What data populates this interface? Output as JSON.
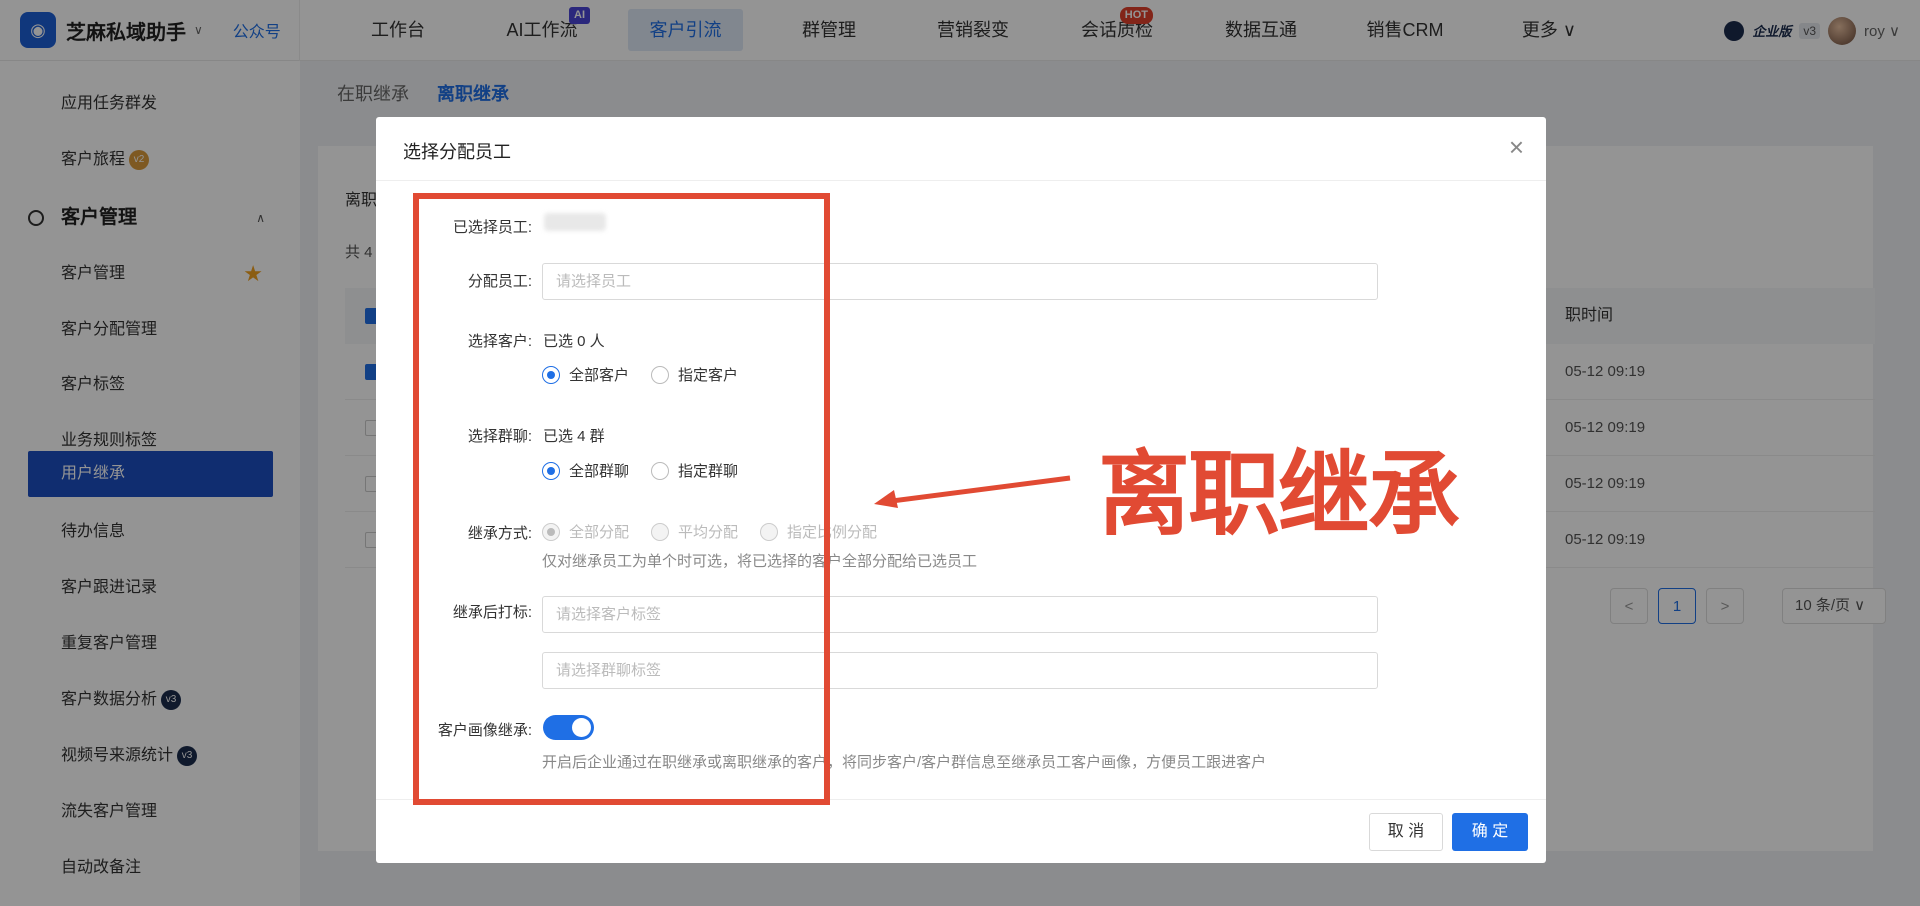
{
  "topbar": {
    "brand": "芝麻私域助手",
    "brand_link": "公众号",
    "nav": [
      {
        "label": "工作台"
      },
      {
        "label": "AI工作流",
        "badge": "AI"
      },
      {
        "label": "客户引流",
        "active": true
      },
      {
        "label": "群管理"
      },
      {
        "label": "营销裂变"
      },
      {
        "label": "会话质检",
        "badge": "HOT"
      },
      {
        "label": "数据互通"
      },
      {
        "label": "销售CRM"
      },
      {
        "label": "更多 ∨"
      }
    ],
    "edition": "企业版",
    "version": "v3",
    "user": "roy ∨"
  },
  "sidebar": {
    "items": [
      {
        "label": "应用任务群发"
      },
      {
        "label": "客户旅程",
        "tag": "v2"
      },
      {
        "label": "客户管理",
        "group": true
      },
      {
        "label": "客户管理",
        "star": true
      },
      {
        "label": "客户分配管理"
      },
      {
        "label": "客户标签"
      },
      {
        "label": "业务规则标签"
      },
      {
        "label": "用户继承",
        "active": true
      },
      {
        "label": "待办信息"
      },
      {
        "label": "客户跟进记录"
      },
      {
        "label": "重复客户管理"
      },
      {
        "label": "客户数据分析",
        "tag": "v3"
      },
      {
        "label": "视频号来源统计",
        "tag": "v3"
      },
      {
        "label": "流失客户管理"
      },
      {
        "label": "自动改备注"
      }
    ]
  },
  "page": {
    "tabs": [
      "在职继承",
      "离职继承"
    ],
    "card_title": "离职",
    "total": "共 4",
    "time_header": "职时间",
    "rows": [
      "05-12 09:19",
      "05-12 09:19",
      "05-12 09:19",
      "05-12 09:19"
    ],
    "pager": {
      "prev": "<",
      "current": "1",
      "next": ">",
      "size": "10 条/页 ∨"
    }
  },
  "modal": {
    "title": "选择分配员工",
    "close": "×",
    "selected_label": "已选择员工:",
    "assign_label": "分配员工:",
    "assign_placeholder": "请选择员工",
    "customer_label": "选择客户:",
    "customer_count": "已选 0 人",
    "customer_options": [
      "全部客户",
      "指定客户"
    ],
    "group_label": "选择群聊:",
    "group_count": "已选 4 群",
    "group_options": [
      "全部群聊",
      "指定群聊"
    ],
    "method_label": "继承方式:",
    "method_options": [
      "全部分配",
      "平均分配",
      "指定比例分配"
    ],
    "method_hint": "仅对继承员工为单个时可选，将已选择的客户全部分配给已选员工",
    "tag_label": "继承后打标:",
    "customer_tag_placeholder": "请选择客户标签",
    "group_tag_placeholder": "请选择群聊标签",
    "portrait_label": "客户画像继承:",
    "portrait_on": true,
    "portrait_hint": "开启后企业通过在职继承或离职继承的客户，将同步客户/客户群信息至继承员工客户画像，方便员工跟进客户",
    "cancel": "取 消",
    "ok": "确 定"
  },
  "annotation": {
    "text": "离职继承",
    "color": "#e14a33"
  }
}
